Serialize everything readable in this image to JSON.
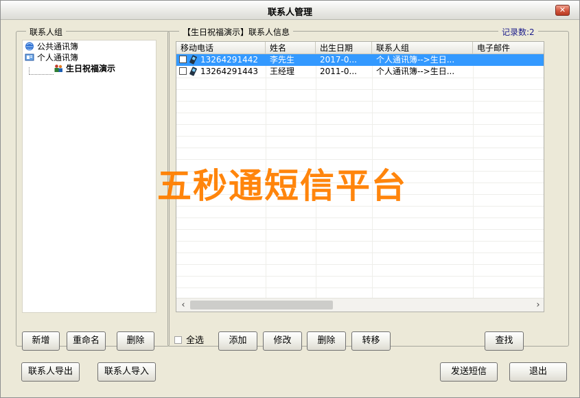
{
  "window": {
    "title": "联系人管理",
    "close_glyph": "✕"
  },
  "left_panel": {
    "label": "联系人组",
    "tree": [
      {
        "label": "公共通讯簿",
        "icon": "public-book-icon"
      },
      {
        "label": "个人通讯簿",
        "icon": "personal-book-icon"
      },
      {
        "label": "生日祝福演示",
        "icon": "group-users-icon",
        "selected": true
      }
    ],
    "buttons": {
      "add": "新增",
      "rename": "重命名",
      "delete": "删除"
    }
  },
  "right_panel": {
    "label": "【生日祝福演示】联系人信息",
    "record_count": "记录数:2",
    "columns": [
      "移动电话",
      "姓名",
      "出生日期",
      "联系人组",
      "电子邮件"
    ],
    "rows": [
      {
        "phone": "13264291442",
        "name": "李先生",
        "birthday": "2017-0...",
        "group": "个人通讯簿-->生日...",
        "email": "",
        "selected": true
      },
      {
        "phone": "13264291443",
        "name": "王经理",
        "birthday": "2011-0...",
        "group": "个人通讯簿-->生日...",
        "email": "",
        "selected": false
      }
    ],
    "select_all": "全选",
    "buttons": {
      "add": "添加",
      "edit": "修改",
      "delete": "删除",
      "move": "转移",
      "find": "查找"
    },
    "scroll_left": "‹",
    "scroll_right": "›"
  },
  "footer": {
    "export": "联系人导出",
    "import": "联系人导入",
    "send_sms": "发送短信",
    "exit": "退出"
  },
  "watermark": "五秒通短信平台",
  "colors": {
    "selection": "#3399ff",
    "watermark": "#ff7f00"
  }
}
